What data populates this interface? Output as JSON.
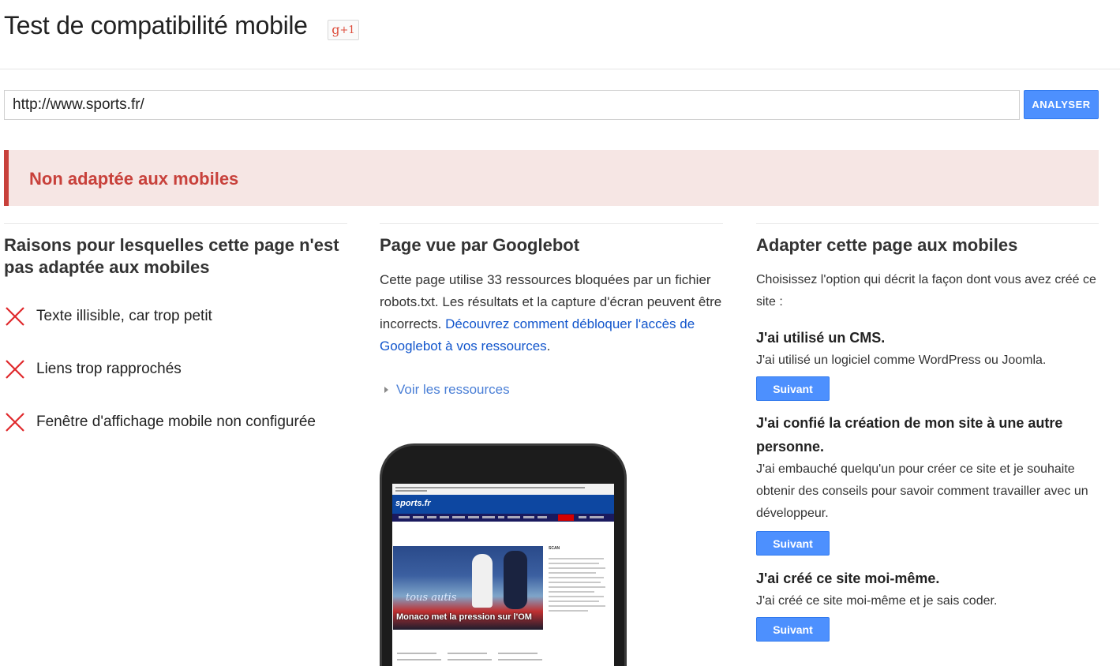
{
  "header": {
    "title": "Test de compatibilité mobile",
    "gplus_label": "g+1"
  },
  "search": {
    "url_value": "http://www.sports.fr/",
    "analyze_label": "ANALYSER"
  },
  "result": {
    "status": "Non adaptée aux mobiles",
    "status_color": "#c8413b"
  },
  "reasons": {
    "title": "Raisons pour lesquelles cette page n'est pas adaptée aux mobiles",
    "items": [
      {
        "label": "Texte illisible, car trop petit",
        "icon": "cross-icon"
      },
      {
        "label": "Liens trop rapprochés",
        "icon": "cross-icon"
      },
      {
        "label": "Fenêtre d'affichage mobile non configurée",
        "icon": "cross-icon"
      }
    ]
  },
  "googlebot": {
    "title": "Page vue par Googlebot",
    "text": "Cette page utilise 33 ressources bloquées par un fichier robots.txt. Les résultats et la capture d'écran peuvent être incorrects.",
    "link_text": "Découvrez comment débloquer l'accès de Googlebot à vos ressources",
    "link_suffix": ".",
    "resources_label": "Voir les ressources",
    "screenshot": {
      "site_logo": "sports.fr",
      "headline": "Monaco met la pression sur l'OM",
      "photo_watermark": "tous autis",
      "side_header": "SCAN"
    }
  },
  "adapt": {
    "title": "Adapter cette page aux mobiles",
    "intro": "Choisissez l'option qui décrit la façon dont vous avez créé ce site :",
    "options": [
      {
        "heading": "J'ai utilisé un CMS.",
        "text": "J'ai utilisé un logiciel comme WordPress ou Joomla.",
        "button": "Suivant"
      },
      {
        "heading": "J'ai confié la création de mon site à une autre personne.",
        "text": "J'ai embauché quelqu'un pour créer ce site et je souhaite obtenir des conseils pour savoir comment travailler avec un développeur.",
        "button": "Suivant"
      },
      {
        "heading": "J'ai créé ce site moi-même.",
        "text": "J'ai créé ce site moi-même et je sais coder.",
        "button": "Suivant"
      }
    ]
  },
  "colors": {
    "accent_button": "#4d90fe",
    "error_red": "#c8413b",
    "link_blue": "#1155cc"
  }
}
